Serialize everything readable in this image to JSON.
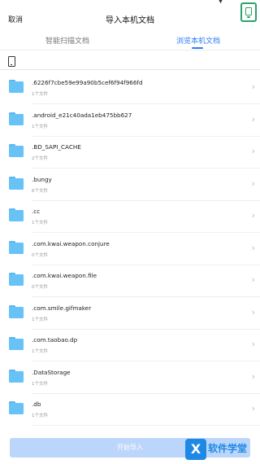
{
  "header": {
    "cancel_label": "取消",
    "title": "导入本机文档"
  },
  "tabs": [
    {
      "label": "智能扫描文档",
      "active": false
    },
    {
      "label": "浏览本机文档",
      "active": true
    }
  ],
  "icons": {
    "device": "phone-icon",
    "folder": "folder-icon",
    "chevron": "chevron-right-icon",
    "side": "phone-frame-icon"
  },
  "colors": {
    "accent": "#2e7cf6",
    "folder": "#67c3f6",
    "button_disabled": "#bcd6fb",
    "badge": "#29a36a"
  },
  "folders": [
    {
      "name": ".6226f7cbe59e99a90b5cef6f94f966fd",
      "count": "1个文件"
    },
    {
      "name": ".android_e21c40ada1eb475bb627",
      "count": "1个文件"
    },
    {
      "name": ".BD_SAPI_CACHE",
      "count": "2个文件"
    },
    {
      "name": ".bungy",
      "count": "6个文件"
    },
    {
      "name": ".cc",
      "count": "1个文件"
    },
    {
      "name": ".com.kwai.weapon.conjure",
      "count": "0个文件"
    },
    {
      "name": ".com.kwai.weapon.file",
      "count": "0个文件"
    },
    {
      "name": ".com.smile.gifmaker",
      "count": "1个文件"
    },
    {
      "name": ".com.taobao.dp",
      "count": "1个文件"
    },
    {
      "name": ".DataStorage",
      "count": "1个文件"
    },
    {
      "name": ".db",
      "count": "1个文件"
    }
  ],
  "footer": {
    "start_import_label": "开始导入",
    "watermark_text": "软件学堂",
    "watermark_glyph": "X"
  }
}
